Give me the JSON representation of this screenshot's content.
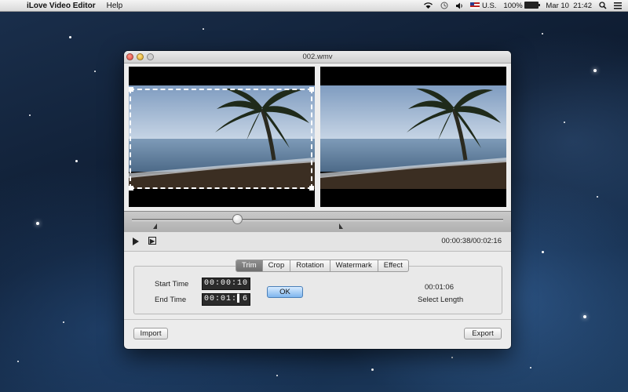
{
  "menubar": {
    "apple_icon": "",
    "app_name": "iLove Video Editor",
    "help": "Help",
    "status": {
      "input_source": "U.S.",
      "battery": "100%",
      "battery_level": 1.0,
      "clock": "Mar 10  21:42"
    }
  },
  "window": {
    "title": "002.wmv"
  },
  "player": {
    "time": "00:00:38/00:02:16",
    "play_icon": "play-icon",
    "step_icon": "frame-step-icon",
    "step_glyph": "▶"
  },
  "tabs": [
    "Trim",
    "Crop",
    "Rotation",
    "Watermark",
    "Effect"
  ],
  "active_tab": "Trim",
  "trim": {
    "start_label": "Start Time",
    "start_value": "00:00:10",
    "end_label": "End Time",
    "end_value": "00:01:▌6",
    "ok_label": "OK",
    "length_value": "00:01:06",
    "length_label": "Select Length"
  },
  "footer": {
    "import_label": "Import",
    "export_label": "Export"
  },
  "colors": {
    "accent_button": "#7fb6ee",
    "active_tab": "#7a7a7a"
  }
}
